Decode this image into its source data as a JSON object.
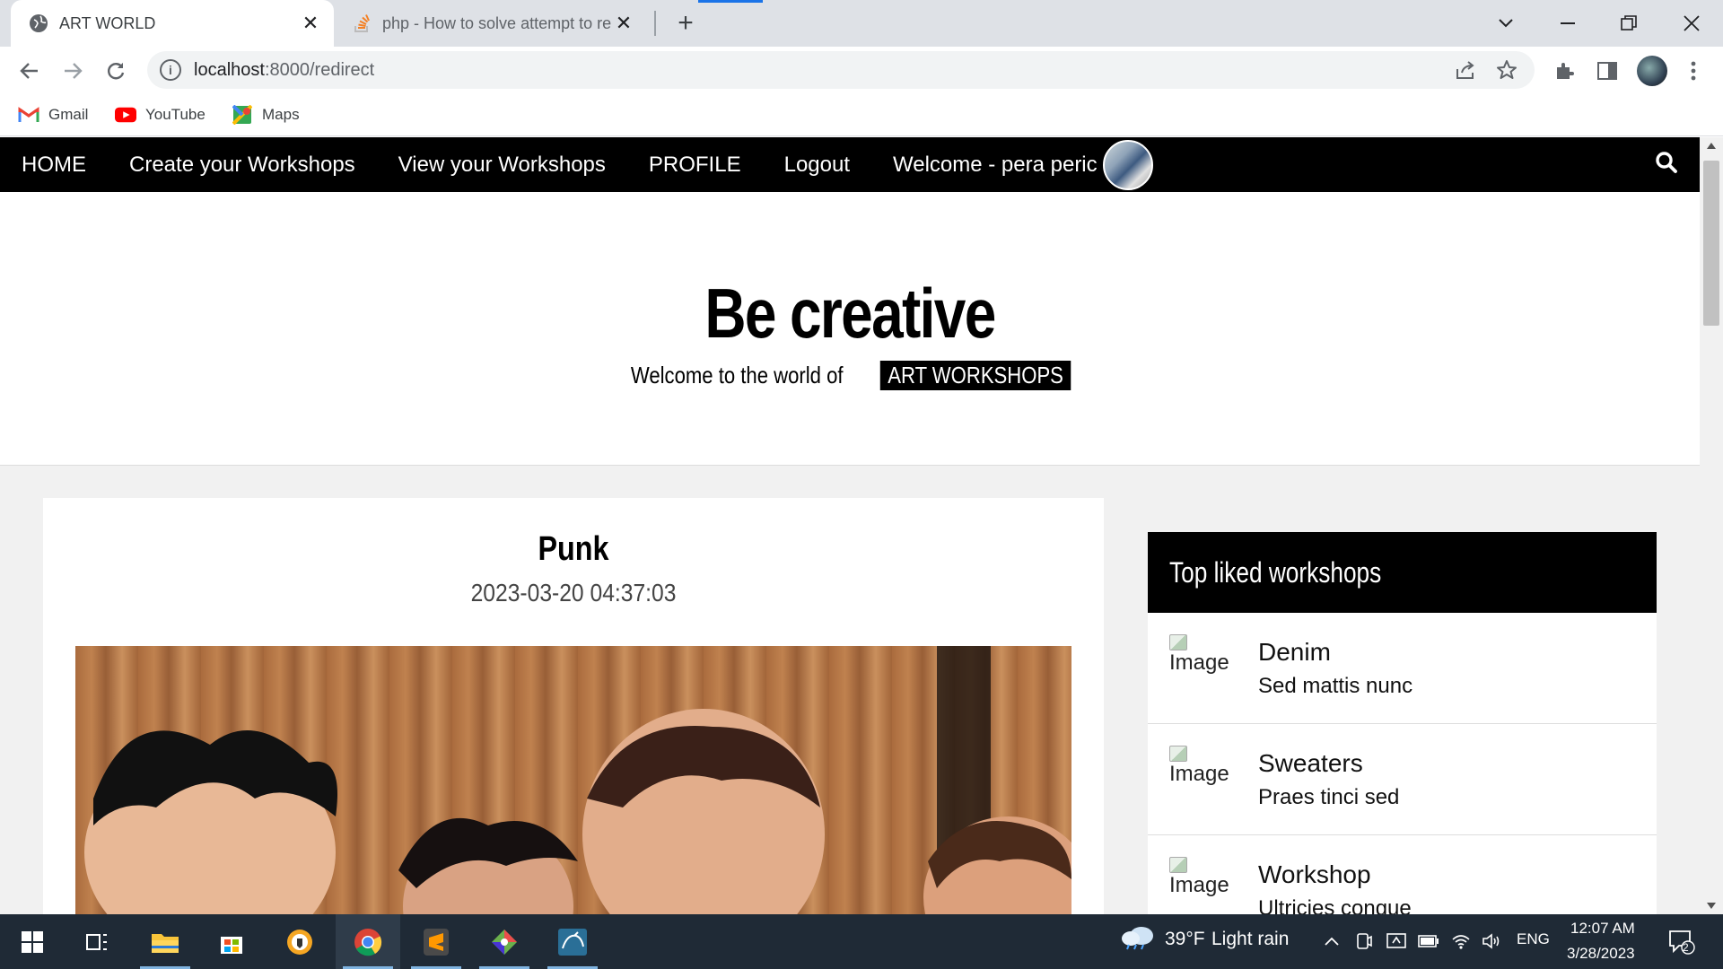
{
  "browser": {
    "tabs": [
      {
        "title": "ART WORLD",
        "active": true
      },
      {
        "title": "php - How to solve attempt to re",
        "active": false
      }
    ],
    "url_host": "localhost",
    "url_rest": ":8000/redirect",
    "bookmarks": [
      {
        "label": "Gmail",
        "icon": "gmail-icon"
      },
      {
        "label": "YouTube",
        "icon": "youtube-icon"
      },
      {
        "label": "Maps",
        "icon": "maps-icon"
      }
    ]
  },
  "site": {
    "nav": {
      "home": "HOME",
      "create": "Create your Workshops",
      "view": "View your Workshops",
      "profile": "PROFILE",
      "logout": "Logout",
      "welcome": "Welcome - pera peric"
    },
    "hero": {
      "title": "Be creative",
      "subtitle": "Welcome to the world of",
      "tag": "ART WORKSHOPS"
    },
    "post": {
      "title": "Punk",
      "date": "2023-03-20 04:37:03"
    },
    "widget": {
      "title": "Top liked workshops",
      "items": [
        {
          "image_alt": "Image",
          "name": "Denim",
          "desc": "Sed mattis nunc"
        },
        {
          "image_alt": "Image",
          "name": "Sweaters",
          "desc": "Praes tinci sed"
        },
        {
          "image_alt": "Image",
          "name": "Workshop",
          "desc": "Ultricies congue"
        }
      ]
    }
  },
  "taskbar": {
    "weather_temp": "39°F",
    "weather_text": "Light rain",
    "lang": "ENG",
    "time": "12:07 AM",
    "date": "3/28/2023",
    "notif_count": "2"
  },
  "colors": {
    "nav_bg": "#000000",
    "chrome_tabstrip": "#dee1e6",
    "taskbar_bg": "#1f2a36",
    "accent": "#1a73e8"
  }
}
